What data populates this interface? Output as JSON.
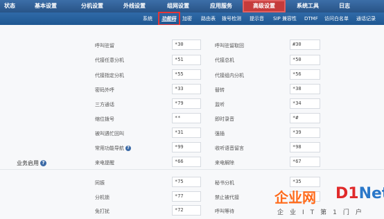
{
  "top_nav": [
    {
      "label": "状态"
    },
    {
      "label": "基本设置"
    },
    {
      "label": "分机设置"
    },
    {
      "label": "外线设置"
    },
    {
      "label": "组网设置"
    },
    {
      "label": "应用服务"
    },
    {
      "label": "高级设置",
      "active": true
    },
    {
      "label": "系统工具"
    },
    {
      "label": "日志"
    }
  ],
  "sub_nav": [
    {
      "label": "系统"
    },
    {
      "label": "功能码",
      "active": true
    },
    {
      "label": "加密"
    },
    {
      "label": "路由表"
    },
    {
      "label": "拨号检测"
    },
    {
      "label": "提示音"
    },
    {
      "label": "SIP 兼容性"
    },
    {
      "label": "DTMF"
    },
    {
      "label": "访问白名单"
    },
    {
      "label": "通话记录"
    }
  ],
  "feature_codes": [
    {
      "left_label": "呼叫驻留",
      "left_value": "*30",
      "right_label": "呼叫驻留取回",
      "right_value": "#30"
    },
    {
      "left_label": "代接任意分机",
      "left_value": "*51",
      "right_label": "代接总机",
      "right_value": "*50"
    },
    {
      "left_label": "代接指定分机",
      "left_value": "*55",
      "right_label": "代接组内分机",
      "right_value": "*56"
    },
    {
      "left_label": "密码外呼",
      "left_value": "*33",
      "right_label": "替转",
      "right_value": "*38"
    },
    {
      "left_label": "三方通话",
      "left_value": "*79",
      "right_label": "监听",
      "right_value": "*34"
    },
    {
      "left_label": "缩位拨号",
      "left_value": "**",
      "right_label": "即时录音",
      "right_value": "*#"
    },
    {
      "left_label": "被叫遇忙回叫",
      "left_value": "*31",
      "right_label": "强插",
      "right_value": "*39"
    },
    {
      "left_label": "常用功能导航",
      "left_value": "*99",
      "left_help": "?",
      "right_label": "收听语音留言",
      "right_value": "*98"
    },
    {
      "left_label": "来电提醒",
      "left_value": "*66",
      "right_label": "来电解除",
      "right_value": "*67"
    }
  ],
  "business_section": {
    "title": "业务启用",
    "help": "?",
    "rows": [
      {
        "left_label": "同振",
        "left_value": "*75",
        "right_label": "秘书分机",
        "right_value": "*35"
      },
      {
        "left_label": "分机锁",
        "left_value": "*77",
        "right_label": "禁止被代接",
        "right_value": ""
      },
      {
        "left_label": "免打扰",
        "left_value": "*72",
        "right_label": "呼叫等待",
        "right_value": ""
      }
    ]
  },
  "watermark": {
    "brand_cn": "企业网",
    "brand_d": "D1",
    "brand_net": "Net",
    "tagline": "企业IT第1门户"
  },
  "colors": {
    "nav_blue": "#2f6aa8",
    "active_red": "#c53b3b",
    "brand_orange": "#ff6a1a",
    "brand_red": "#e02a2a",
    "brand_blue": "#2b78c9"
  }
}
